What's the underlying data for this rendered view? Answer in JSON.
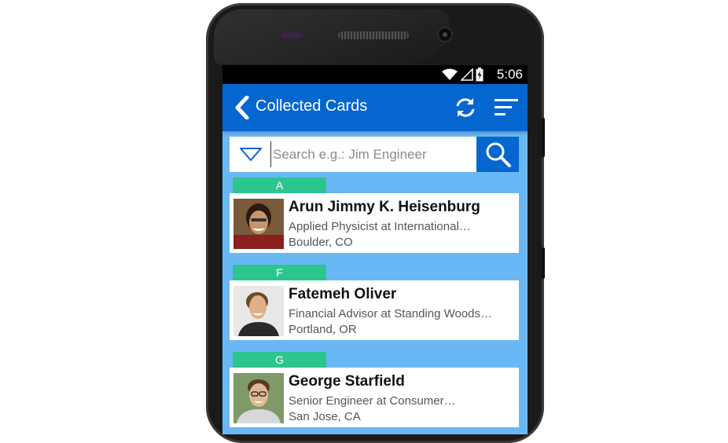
{
  "status_bar": {
    "time": "5:06",
    "icons": [
      "wifi-icon",
      "signal-icon",
      "battery-charging-icon"
    ]
  },
  "action_bar": {
    "title": "Collected Cards",
    "back_icon": "chevron-left-icon",
    "refresh_icon": "refresh-icon",
    "sort_icon": "sort-icon"
  },
  "search": {
    "placeholder": "Search e.g.: Jim Engineer",
    "value": "",
    "filter_icon": "triangle-down-icon",
    "search_icon": "magnifier-icon"
  },
  "colors": {
    "action_bar": "#0566cf",
    "background": "#6ab7f5",
    "section_tab": "#2cc58e"
  },
  "contacts": [
    {
      "section": "A",
      "name": "Arun Jimmy K. Heisenburg",
      "title": "Applied Physicist at International…",
      "location": "Boulder, CO"
    },
    {
      "section": "F",
      "name": "Fatemeh Oliver",
      "title": "Financial Advisor at Standing Woods…",
      "location": "Portland, OR"
    },
    {
      "section": "G",
      "name": "George Starfield",
      "title": "Senior Engineer at Consumer…",
      "location": "San Jose, CA"
    }
  ]
}
